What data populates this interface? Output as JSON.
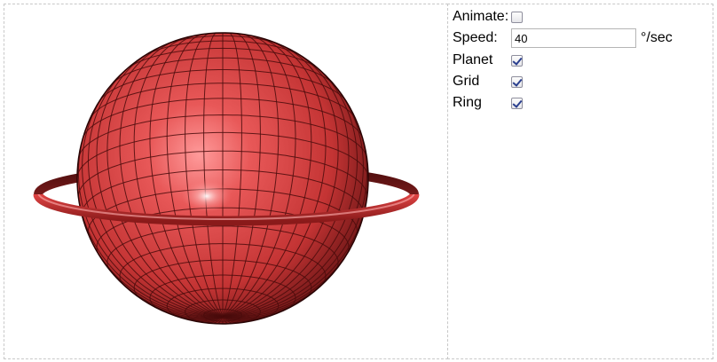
{
  "controls": {
    "animate": {
      "label": "Animate:",
      "checked": false
    },
    "speed": {
      "label": "Speed:",
      "value": "40",
      "unit": "°/sec"
    },
    "planet": {
      "label": "Planet",
      "checked": true
    },
    "grid": {
      "label": "Grid",
      "checked": true
    },
    "ring": {
      "label": "Ring",
      "checked": true
    }
  },
  "colors": {
    "planet_light": "#f07070",
    "planet_mid": "#c83838",
    "planet_dark": "#5a1010",
    "grid_line": "#4a0c0c",
    "ring": "#e04a4a"
  }
}
